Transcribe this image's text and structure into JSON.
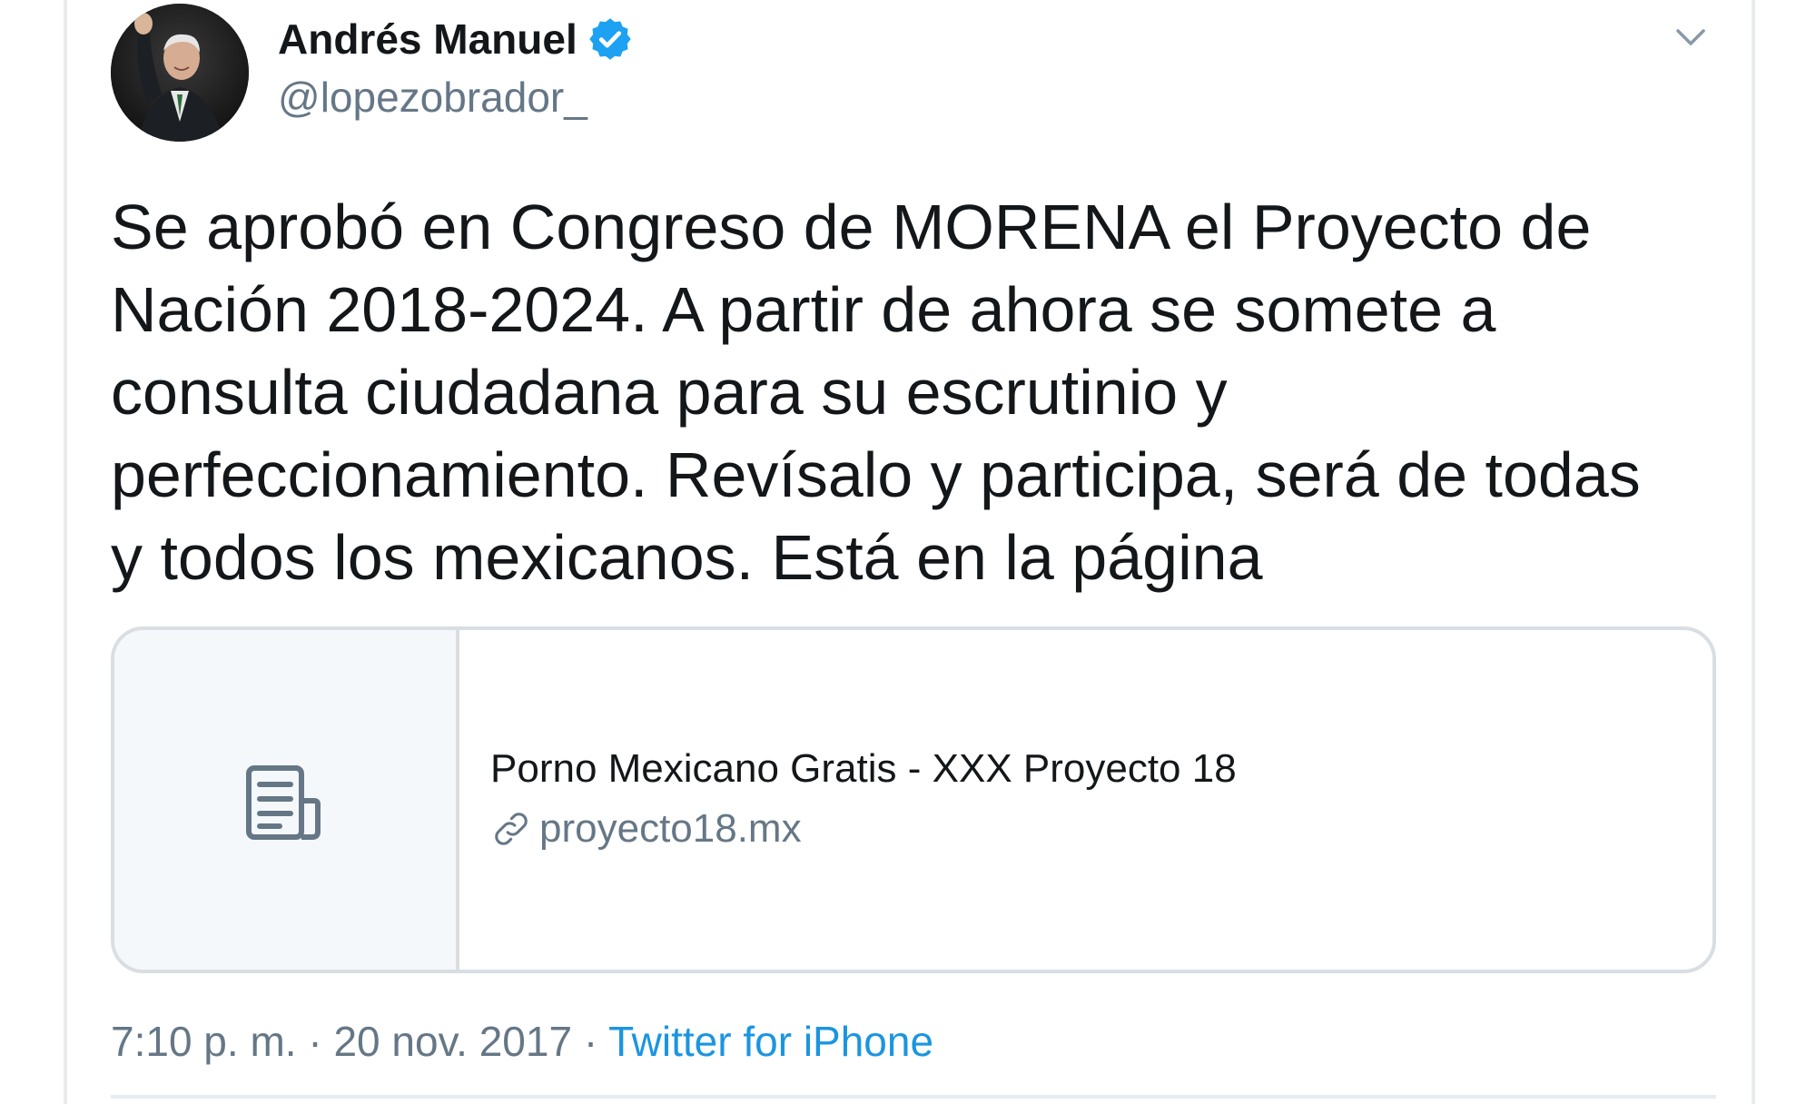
{
  "tweet": {
    "author": {
      "name": "Andrés Manuel",
      "handle": "@lopezobrador_",
      "verified_icon": "verified-badge-icon",
      "avatar_icon": "avatar"
    },
    "text_lines": [
      "Se aprobó en Congreso de MORENA el Proyecto de",
      "Nación 2018-2024. A partir de ahora se somete a",
      "consulta ciudadana para su escrutinio y",
      "perfeccionamiento. Revísalo y participa, será de todas",
      "y todos los mexicanos. Está en la página"
    ],
    "card": {
      "title": "Porno Mexicano Gratis - XXX Proyecto 18",
      "url": "proyecto18.mx",
      "thumb_icon": "document-icon",
      "url_icon": "link-icon"
    },
    "meta": {
      "time": "7:10 p. m.",
      "separator": " · ",
      "date": "20 nov. 2017",
      "source": "Twitter for iPhone"
    },
    "menu_icon": "chevron-down-icon"
  },
  "colors": {
    "text_primary": "#14171a",
    "text_secondary": "#657786",
    "link": "#1b95e0",
    "verified": "#1da1f2",
    "border": "#d9dee2"
  }
}
